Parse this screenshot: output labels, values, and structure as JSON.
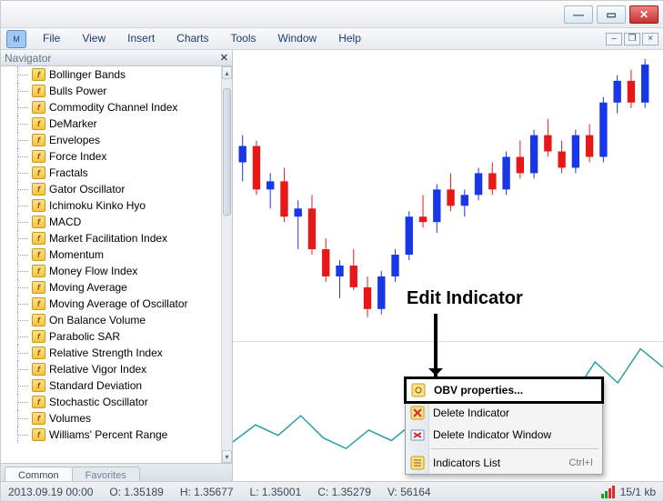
{
  "menus": [
    "File",
    "View",
    "Insert",
    "Charts",
    "Tools",
    "Window",
    "Help"
  ],
  "nav": {
    "title": "Navigator",
    "tabs": [
      "Common",
      "Favorites"
    ],
    "items": [
      "Bollinger Bands",
      "Bulls Power",
      "Commodity Channel Index",
      "DeMarker",
      "Envelopes",
      "Force Index",
      "Fractals",
      "Gator Oscillator",
      "Ichimoku Kinko Hyo",
      "MACD",
      "Market Facilitation Index",
      "Momentum",
      "Money Flow Index",
      "Moving Average",
      "Moving Average of Oscillator",
      "On Balance Volume",
      "Parabolic SAR",
      "Relative Strength Index",
      "Relative Vigor Index",
      "Standard Deviation",
      "Stochastic Oscillator",
      "Volumes",
      "Williams' Percent Range"
    ]
  },
  "ctx": {
    "properties": "OBV properties...",
    "delete_ind": "Delete Indicator",
    "delete_win": "Delete Indicator Window",
    "ind_list": "Indicators List",
    "ind_list_short": "Ctrl+I"
  },
  "annotation": "Edit Indicator",
  "status": {
    "datetime": "2013.09.19 00:00",
    "o": "O: 1.35189",
    "h": "H: 1.35677",
    "l": "L: 1.35001",
    "c": "C: 1.35279",
    "v": "V: 56164",
    "conn": "15/1 kb"
  },
  "chart_data": {
    "type": "candlestick+line",
    "main_series": {
      "description": "price candlesticks",
      "candles": [
        {
          "x": 0,
          "o": 62,
          "h": 72,
          "l": 55,
          "c": 68,
          "color": "blue"
        },
        {
          "x": 1,
          "o": 68,
          "h": 70,
          "l": 50,
          "c": 52,
          "color": "red"
        },
        {
          "x": 2,
          "o": 52,
          "h": 58,
          "l": 45,
          "c": 55,
          "color": "blue"
        },
        {
          "x": 3,
          "o": 55,
          "h": 60,
          "l": 40,
          "c": 42,
          "color": "red"
        },
        {
          "x": 4,
          "o": 42,
          "h": 48,
          "l": 30,
          "c": 45,
          "color": "blue"
        },
        {
          "x": 5,
          "o": 45,
          "h": 50,
          "l": 28,
          "c": 30,
          "color": "red"
        },
        {
          "x": 6,
          "o": 30,
          "h": 34,
          "l": 18,
          "c": 20,
          "color": "red"
        },
        {
          "x": 7,
          "o": 20,
          "h": 26,
          "l": 12,
          "c": 24,
          "color": "blue"
        },
        {
          "x": 8,
          "o": 24,
          "h": 30,
          "l": 15,
          "c": 16,
          "color": "red"
        },
        {
          "x": 9,
          "o": 16,
          "h": 20,
          "l": 5,
          "c": 8,
          "color": "red"
        },
        {
          "x": 10,
          "o": 8,
          "h": 22,
          "l": 6,
          "c": 20,
          "color": "blue"
        },
        {
          "x": 11,
          "o": 20,
          "h": 30,
          "l": 18,
          "c": 28,
          "color": "blue"
        },
        {
          "x": 12,
          "o": 28,
          "h": 44,
          "l": 26,
          "c": 42,
          "color": "blue"
        },
        {
          "x": 13,
          "o": 42,
          "h": 50,
          "l": 38,
          "c": 40,
          "color": "red"
        },
        {
          "x": 14,
          "o": 40,
          "h": 54,
          "l": 36,
          "c": 52,
          "color": "blue"
        },
        {
          "x": 15,
          "o": 52,
          "h": 58,
          "l": 44,
          "c": 46,
          "color": "red"
        },
        {
          "x": 16,
          "o": 46,
          "h": 52,
          "l": 42,
          "c": 50,
          "color": "blue"
        },
        {
          "x": 17,
          "o": 50,
          "h": 60,
          "l": 48,
          "c": 58,
          "color": "blue"
        },
        {
          "x": 18,
          "o": 58,
          "h": 62,
          "l": 50,
          "c": 52,
          "color": "red"
        },
        {
          "x": 19,
          "o": 52,
          "h": 66,
          "l": 50,
          "c": 64,
          "color": "blue"
        },
        {
          "x": 20,
          "o": 64,
          "h": 70,
          "l": 56,
          "c": 58,
          "color": "red"
        },
        {
          "x": 21,
          "o": 58,
          "h": 74,
          "l": 56,
          "c": 72,
          "color": "blue"
        },
        {
          "x": 22,
          "o": 72,
          "h": 78,
          "l": 64,
          "c": 66,
          "color": "red"
        },
        {
          "x": 23,
          "o": 66,
          "h": 70,
          "l": 58,
          "c": 60,
          "color": "red"
        },
        {
          "x": 24,
          "o": 60,
          "h": 74,
          "l": 58,
          "c": 72,
          "color": "blue"
        },
        {
          "x": 25,
          "o": 72,
          "h": 76,
          "l": 62,
          "c": 64,
          "color": "red"
        },
        {
          "x": 26,
          "o": 64,
          "h": 86,
          "l": 62,
          "c": 84,
          "color": "blue"
        },
        {
          "x": 27,
          "o": 84,
          "h": 94,
          "l": 80,
          "c": 92,
          "color": "blue"
        },
        {
          "x": 28,
          "o": 92,
          "h": 96,
          "l": 82,
          "c": 84,
          "color": "red"
        },
        {
          "x": 29,
          "o": 84,
          "h": 100,
          "l": 82,
          "c": 98,
          "color": "blue"
        }
      ],
      "yrange": [
        0,
        100
      ]
    },
    "indicator_series": {
      "name": "OBV",
      "color": "#2aa0a0",
      "points": [
        15,
        28,
        20,
        35,
        18,
        10,
        24,
        16,
        30,
        22,
        48,
        38,
        58,
        44,
        64,
        50,
        76,
        60,
        86,
        72
      ]
    }
  }
}
